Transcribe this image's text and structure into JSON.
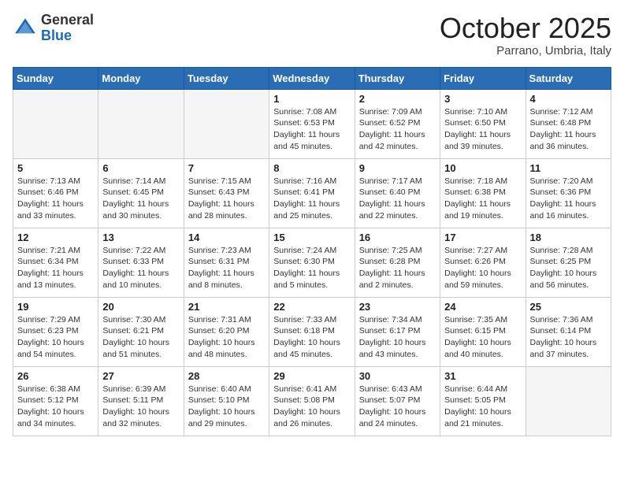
{
  "header": {
    "logo_general": "General",
    "logo_blue": "Blue",
    "month_title": "October 2025",
    "subtitle": "Parrano, Umbria, Italy"
  },
  "days_of_week": [
    "Sunday",
    "Monday",
    "Tuesday",
    "Wednesday",
    "Thursday",
    "Friday",
    "Saturday"
  ],
  "weeks": [
    [
      {
        "day": "",
        "info": ""
      },
      {
        "day": "",
        "info": ""
      },
      {
        "day": "",
        "info": ""
      },
      {
        "day": "1",
        "info": "Sunrise: 7:08 AM\nSunset: 6:53 PM\nDaylight: 11 hours and 45 minutes."
      },
      {
        "day": "2",
        "info": "Sunrise: 7:09 AM\nSunset: 6:52 PM\nDaylight: 11 hours and 42 minutes."
      },
      {
        "day": "3",
        "info": "Sunrise: 7:10 AM\nSunset: 6:50 PM\nDaylight: 11 hours and 39 minutes."
      },
      {
        "day": "4",
        "info": "Sunrise: 7:12 AM\nSunset: 6:48 PM\nDaylight: 11 hours and 36 minutes."
      }
    ],
    [
      {
        "day": "5",
        "info": "Sunrise: 7:13 AM\nSunset: 6:46 PM\nDaylight: 11 hours and 33 minutes."
      },
      {
        "day": "6",
        "info": "Sunrise: 7:14 AM\nSunset: 6:45 PM\nDaylight: 11 hours and 30 minutes."
      },
      {
        "day": "7",
        "info": "Sunrise: 7:15 AM\nSunset: 6:43 PM\nDaylight: 11 hours and 28 minutes."
      },
      {
        "day": "8",
        "info": "Sunrise: 7:16 AM\nSunset: 6:41 PM\nDaylight: 11 hours and 25 minutes."
      },
      {
        "day": "9",
        "info": "Sunrise: 7:17 AM\nSunset: 6:40 PM\nDaylight: 11 hours and 22 minutes."
      },
      {
        "day": "10",
        "info": "Sunrise: 7:18 AM\nSunset: 6:38 PM\nDaylight: 11 hours and 19 minutes."
      },
      {
        "day": "11",
        "info": "Sunrise: 7:20 AM\nSunset: 6:36 PM\nDaylight: 11 hours and 16 minutes."
      }
    ],
    [
      {
        "day": "12",
        "info": "Sunrise: 7:21 AM\nSunset: 6:34 PM\nDaylight: 11 hours and 13 minutes."
      },
      {
        "day": "13",
        "info": "Sunrise: 7:22 AM\nSunset: 6:33 PM\nDaylight: 11 hours and 10 minutes."
      },
      {
        "day": "14",
        "info": "Sunrise: 7:23 AM\nSunset: 6:31 PM\nDaylight: 11 hours and 8 minutes."
      },
      {
        "day": "15",
        "info": "Sunrise: 7:24 AM\nSunset: 6:30 PM\nDaylight: 11 hours and 5 minutes."
      },
      {
        "day": "16",
        "info": "Sunrise: 7:25 AM\nSunset: 6:28 PM\nDaylight: 11 hours and 2 minutes."
      },
      {
        "day": "17",
        "info": "Sunrise: 7:27 AM\nSunset: 6:26 PM\nDaylight: 10 hours and 59 minutes."
      },
      {
        "day": "18",
        "info": "Sunrise: 7:28 AM\nSunset: 6:25 PM\nDaylight: 10 hours and 56 minutes."
      }
    ],
    [
      {
        "day": "19",
        "info": "Sunrise: 7:29 AM\nSunset: 6:23 PM\nDaylight: 10 hours and 54 minutes."
      },
      {
        "day": "20",
        "info": "Sunrise: 7:30 AM\nSunset: 6:21 PM\nDaylight: 10 hours and 51 minutes."
      },
      {
        "day": "21",
        "info": "Sunrise: 7:31 AM\nSunset: 6:20 PM\nDaylight: 10 hours and 48 minutes."
      },
      {
        "day": "22",
        "info": "Sunrise: 7:33 AM\nSunset: 6:18 PM\nDaylight: 10 hours and 45 minutes."
      },
      {
        "day": "23",
        "info": "Sunrise: 7:34 AM\nSunset: 6:17 PM\nDaylight: 10 hours and 43 minutes."
      },
      {
        "day": "24",
        "info": "Sunrise: 7:35 AM\nSunset: 6:15 PM\nDaylight: 10 hours and 40 minutes."
      },
      {
        "day": "25",
        "info": "Sunrise: 7:36 AM\nSunset: 6:14 PM\nDaylight: 10 hours and 37 minutes."
      }
    ],
    [
      {
        "day": "26",
        "info": "Sunrise: 6:38 AM\nSunset: 5:12 PM\nDaylight: 10 hours and 34 minutes."
      },
      {
        "day": "27",
        "info": "Sunrise: 6:39 AM\nSunset: 5:11 PM\nDaylight: 10 hours and 32 minutes."
      },
      {
        "day": "28",
        "info": "Sunrise: 6:40 AM\nSunset: 5:10 PM\nDaylight: 10 hours and 29 minutes."
      },
      {
        "day": "29",
        "info": "Sunrise: 6:41 AM\nSunset: 5:08 PM\nDaylight: 10 hours and 26 minutes."
      },
      {
        "day": "30",
        "info": "Sunrise: 6:43 AM\nSunset: 5:07 PM\nDaylight: 10 hours and 24 minutes."
      },
      {
        "day": "31",
        "info": "Sunrise: 6:44 AM\nSunset: 5:05 PM\nDaylight: 10 hours and 21 minutes."
      },
      {
        "day": "",
        "info": ""
      }
    ]
  ]
}
